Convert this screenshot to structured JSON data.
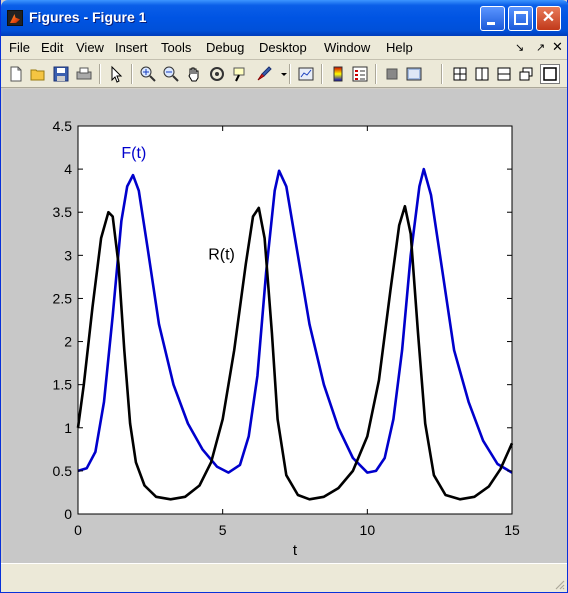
{
  "window": {
    "title": "Figures - Figure 1"
  },
  "menu": {
    "items": [
      "File",
      "Edit",
      "View",
      "Insert",
      "Tools",
      "Debug",
      "Desktop",
      "Window",
      "Help"
    ]
  },
  "toolbar": {
    "icons": [
      "new-file-icon",
      "open-folder-icon",
      "save-icon",
      "print-icon",
      "pointer-icon",
      "zoom-in-icon",
      "zoom-out-icon",
      "pan-icon",
      "rotate-3d-icon",
      "data-cursor-icon",
      "brush-icon",
      "link-plot-icon",
      "colorbar-icon",
      "legend-icon",
      "hide-plot-tools-icon",
      "show-plot-tools-icon",
      "tile-grid-icon",
      "tile-columns-icon",
      "tile-rows-icon",
      "float-icon",
      "maximize-icon"
    ]
  },
  "colors": {
    "F": "#0000cc",
    "R": "#000000",
    "figure_bg": "#c8c8c8"
  },
  "chart_data": {
    "type": "line",
    "xlabel": "t",
    "ylabel": "",
    "xlim": [
      0,
      15
    ],
    "ylim": [
      0,
      4.5
    ],
    "xticks": [
      0,
      5,
      10,
      15
    ],
    "yticks": [
      "0",
      "0.5",
      "1",
      "1.5",
      "2",
      "2.5",
      "3",
      "3.5",
      "4",
      "4.5"
    ],
    "annotations": [
      "F(t)",
      "R(t)"
    ],
    "series": [
      {
        "name": "F(t)",
        "color": "#0000cc",
        "x": [
          0,
          0.3,
          0.6,
          0.9,
          1.2,
          1.5,
          1.7,
          1.9,
          2.1,
          2.4,
          2.8,
          3.3,
          3.8,
          4.3,
          4.8,
          5.2,
          5.6,
          5.9,
          6.2,
          6.5,
          6.8,
          6.95,
          7.2,
          7.5,
          8.0,
          8.5,
          9.0,
          9.5,
          10.0,
          10.3,
          10.6,
          10.9,
          11.2,
          11.5,
          11.8,
          11.95,
          12.2,
          12.6,
          13.0,
          13.5,
          14.0,
          14.5,
          15.0
        ],
        "y": [
          0.5,
          0.53,
          0.72,
          1.3,
          2.3,
          3.4,
          3.8,
          3.93,
          3.75,
          3.1,
          2.2,
          1.5,
          1.05,
          0.75,
          0.55,
          0.48,
          0.57,
          0.9,
          1.6,
          2.8,
          3.75,
          3.98,
          3.8,
          3.2,
          2.2,
          1.5,
          1.0,
          0.65,
          0.48,
          0.5,
          0.65,
          1.1,
          1.9,
          3.0,
          3.8,
          4.0,
          3.7,
          2.8,
          1.9,
          1.3,
          0.85,
          0.58,
          0.48
        ]
      },
      {
        "name": "R(t)",
        "color": "#000000",
        "x": [
          0,
          0.2,
          0.5,
          0.8,
          1.05,
          1.2,
          1.4,
          1.6,
          1.8,
          2.0,
          2.3,
          2.7,
          3.2,
          3.7,
          4.2,
          4.6,
          5.0,
          5.4,
          5.8,
          6.05,
          6.25,
          6.45,
          6.7,
          6.9,
          7.2,
          7.6,
          8.0,
          8.5,
          9.0,
          9.5,
          10.0,
          10.4,
          10.8,
          11.1,
          11.3,
          11.5,
          11.75,
          12.0,
          12.3,
          12.7,
          13.2,
          13.7,
          14.2,
          14.6,
          15.0
        ],
        "y": [
          1.0,
          1.5,
          2.4,
          3.2,
          3.5,
          3.45,
          2.9,
          1.9,
          1.05,
          0.6,
          0.33,
          0.2,
          0.17,
          0.2,
          0.33,
          0.6,
          1.1,
          1.9,
          2.9,
          3.45,
          3.55,
          3.2,
          2.1,
          1.1,
          0.45,
          0.22,
          0.17,
          0.2,
          0.3,
          0.5,
          0.9,
          1.55,
          2.6,
          3.35,
          3.57,
          3.25,
          2.1,
          1.05,
          0.45,
          0.22,
          0.17,
          0.2,
          0.32,
          0.52,
          0.82
        ]
      }
    ]
  }
}
